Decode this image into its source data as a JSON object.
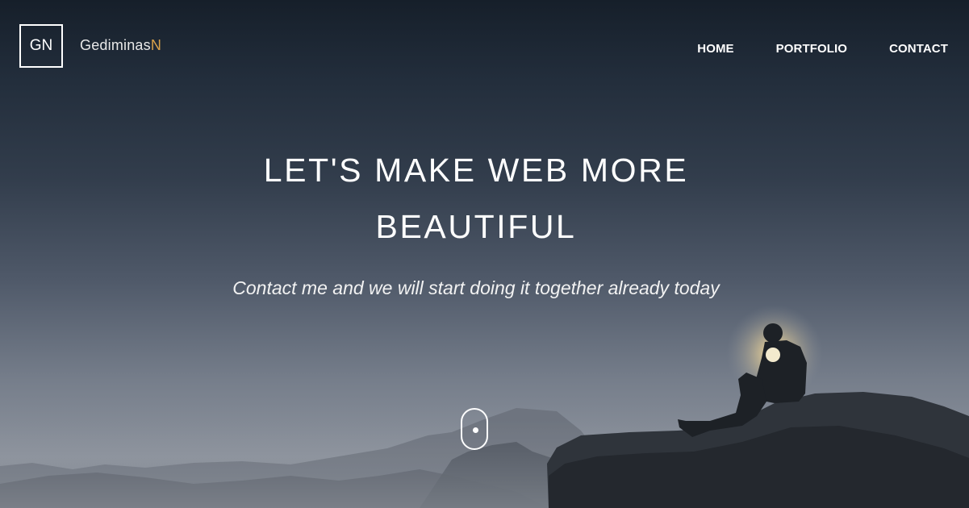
{
  "header": {
    "logo_text": "GN",
    "brand_main": "Gediminas",
    "brand_accent": "N",
    "nav": [
      {
        "label": "HOME"
      },
      {
        "label": "PORTFOLIO"
      },
      {
        "label": "CONTACT"
      }
    ]
  },
  "hero": {
    "headline_line1": "LET'S MAKE WEB MORE",
    "headline_line2": "BEAUTIFUL",
    "subline": "Contact me and we will start doing it together already today"
  },
  "colors": {
    "brand_accent": "#d9a24a",
    "text": "#ffffff"
  },
  "icons": {
    "scroll_indicator": "mouse-scroll-icon"
  }
}
